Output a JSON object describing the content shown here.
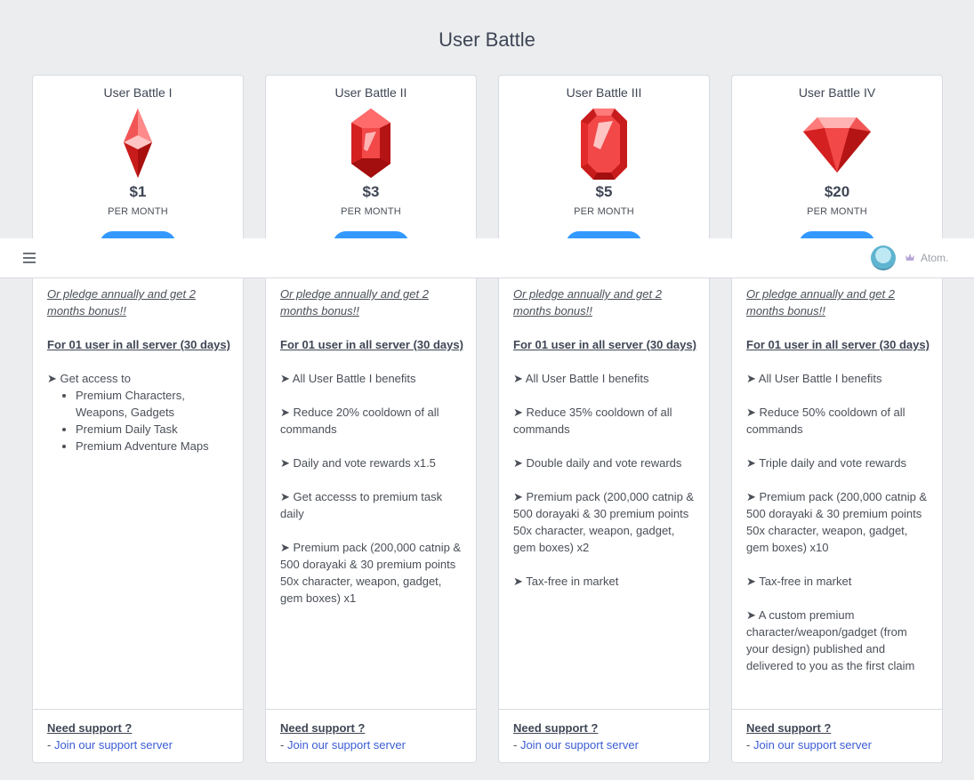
{
  "page": {
    "title": "User Battle"
  },
  "common": {
    "per_month": "PER MONTH",
    "annual_note": "Or pledge annually and get 2 months bonus!!",
    "for_line": "For 01 user in all server (30 days)",
    "support_title": "Need support ?",
    "support_prefix": "- ",
    "support_link": "Join our support server"
  },
  "topbar": {
    "user_name": "Atom."
  },
  "cards": [
    {
      "title": "User Battle I",
      "price": "$1",
      "gem_icon": "red-crystal-shard-icon",
      "intro": "➤ Get access to",
      "sub_items": [
        "Premium Characters, Weapons, Gadgets",
        "Premium Daily Task",
        "Premium Adventure Maps"
      ],
      "benefits": []
    },
    {
      "title": "User Battle II",
      "price": "$3",
      "gem_icon": "red-hexagon-gem-icon",
      "benefits": [
        "➤ All User Battle I benefits",
        "➤ Reduce 20% cooldown of all commands",
        "➤ Daily and vote rewards x1.5",
        "➤ Get accesss to premium task daily",
        "➤ Premium pack (200,000 catnip & 500 dorayaki & 30 premium points 50x character, weapon, gadget, gem boxes) x1"
      ]
    },
    {
      "title": "User Battle III",
      "price": "$5",
      "gem_icon": "red-octagon-gem-icon",
      "benefits": [
        "➤ All User Battle I benefits",
        "➤ Reduce 35% cooldown of all commands",
        "➤ Double daily and vote rewards",
        "➤ Premium pack (200,000 catnip & 500 dorayaki & 30 premium points 50x character, weapon, gadget, gem boxes) x2",
        "➤ Tax-free in market"
      ]
    },
    {
      "title": "User Battle IV",
      "price": "$20",
      "gem_icon": "red-diamond-icon",
      "benefits": [
        "➤ All User Battle I benefits",
        "➤ Reduce 50% cooldown of all commands",
        "➤ Triple daily and vote rewards",
        "➤ Premium pack (200,000 catnip & 500 dorayaki & 30 premium points 50x character, weapon, gadget, gem boxes) x10",
        "➤ Tax-free in market",
        "➤ A custom premium character/weapon/gadget (from your design) published and delivered to you as the first claim"
      ]
    }
  ],
  "colors": {
    "accent": "#3399ff",
    "link": "#3b5cd4",
    "gem": "#e32b2b",
    "background": "#ebedef"
  }
}
